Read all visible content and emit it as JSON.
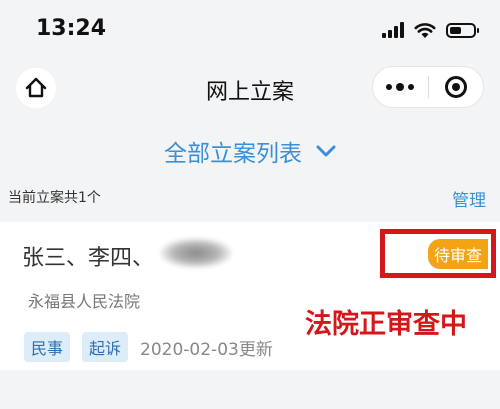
{
  "status_bar": {
    "time": "13:24"
  },
  "nav": {
    "title": "网上立案"
  },
  "list_selector": {
    "label": "全部立案列表"
  },
  "summary": {
    "count_text": "当前立案共1个",
    "manage_label": "管理"
  },
  "case": {
    "parties": "张三、李四、",
    "court": "永福县人民法院",
    "tags": [
      "民事",
      "起诉"
    ],
    "updated": "2020-02-03更新",
    "status": "待审查"
  },
  "annotation": {
    "text": "法院正审查中"
  },
  "colors": {
    "accent": "#3b8fd6",
    "status_badge": "#f3a414",
    "annotation_red": "#d3171a",
    "tag_bg": "#dcecf9"
  },
  "icons": {
    "home": "home-icon",
    "more": "more-dots-icon",
    "close": "target-icon",
    "dropdown": "chevron-down-icon"
  }
}
